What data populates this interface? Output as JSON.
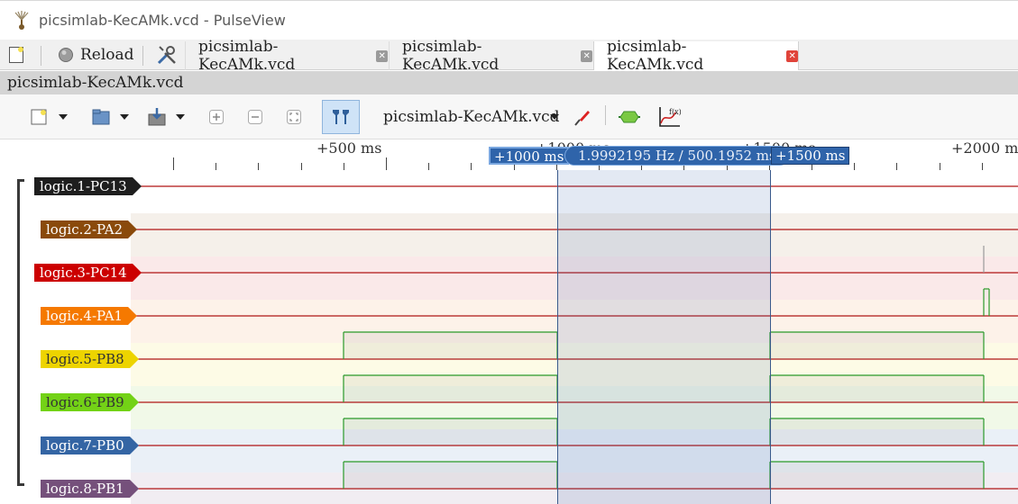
{
  "window": {
    "title": "picsimlab-KecAMk.vcd - PulseView"
  },
  "main_bar": {
    "reload_label": "Reload",
    "tabs": [
      {
        "label": "picsimlab-KecAMk.vcd",
        "active": false
      },
      {
        "label": "picsimlab-KecAMk.vcd",
        "active": false
      },
      {
        "label": "picsimlab-KecAMk.vcd",
        "active": true
      }
    ]
  },
  "session": {
    "name": "picsimlab-KecAMk.vcd"
  },
  "toolbar": {
    "device": "picsimlab-KecAMk.vcd"
  },
  "ruler": {
    "labels": [
      "+500 ms",
      "+1000 ms",
      "+1500 ms",
      "+2000 ms"
    ]
  },
  "cursors": {
    "left": "+1000 ms",
    "right": "+1500 ms",
    "delta": "1.9992195 Hz / 500.1952 ms"
  },
  "signals": [
    {
      "label": "logic.1-PC13",
      "color": "#1e1e1e",
      "text_color": "#ffffff",
      "bg": "#ffffff"
    },
    {
      "label": "logic.2-PA2",
      "color": "#8a4a0b",
      "text_color": "#ffffff",
      "bg": "#f5f0ea"
    },
    {
      "label": "logic.3-PC14",
      "color": "#cc0000",
      "text_color": "#ffffff",
      "bg": "#fae9e9"
    },
    {
      "label": "logic.4-PA1",
      "color": "#f57900",
      "text_color": "#ffffff",
      "bg": "#fdf2e9"
    },
    {
      "label": "logic.5-PB8",
      "color": "#edd400",
      "text_color": "#333333",
      "bg": "#fdfbe6"
    },
    {
      "label": "logic.6-PB9",
      "color": "#73d216",
      "text_color": "#333333",
      "bg": "#f1f9e8"
    },
    {
      "label": "logic.7-PB0",
      "color": "#3465a4",
      "text_color": "#ffffff",
      "bg": "#eaf0f7"
    },
    {
      "label": "logic.8-PB1",
      "color": "#75507b",
      "text_color": "#ffffff",
      "bg": "#f1edf2"
    }
  ],
  "colors": {
    "low_trace": "#b01515",
    "high_trace": "#2a9a2a",
    "cursor_fill": "#c9d6ea"
  }
}
